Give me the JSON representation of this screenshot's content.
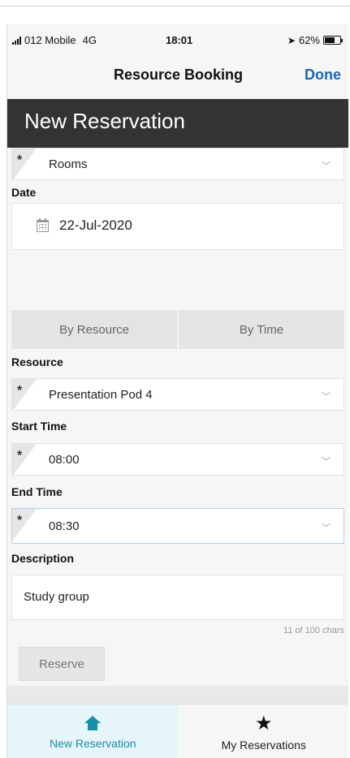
{
  "status_bar": {
    "carrier": "012 Mobile",
    "network": "4G",
    "time": "18:01",
    "battery": "62%",
    "battery_level": 0.62
  },
  "nav": {
    "title": "Resource Booking",
    "done_label": "Done"
  },
  "page_title": "New Reservation",
  "form": {
    "category": {
      "value": "Rooms",
      "required_mark": "*"
    },
    "date": {
      "label": "Date",
      "value": "22-Jul-2020"
    },
    "mode_tabs": [
      "By Resource",
      "By Time"
    ],
    "resource": {
      "label": "Resource",
      "value": "Presentation Pod 4",
      "required_mark": "*"
    },
    "start_time": {
      "label": "Start Time",
      "value": "08:00",
      "required_mark": "*"
    },
    "end_time": {
      "label": "End Time",
      "value": "08:30",
      "required_mark": "*"
    },
    "description": {
      "label": "Description",
      "value": "Study group",
      "counter": "11 of 100 chars"
    },
    "reserve_label": "Reserve"
  },
  "tabbar": {
    "tabs": [
      {
        "label": "New Reservation",
        "icon": "home-icon",
        "active": true
      },
      {
        "label": "My Reservations",
        "icon": "star-icon",
        "active": false
      }
    ]
  },
  "colors": {
    "header_bg": "#333333",
    "accent_blue": "#1a66b8",
    "tab_active": "#1a8ea8"
  }
}
